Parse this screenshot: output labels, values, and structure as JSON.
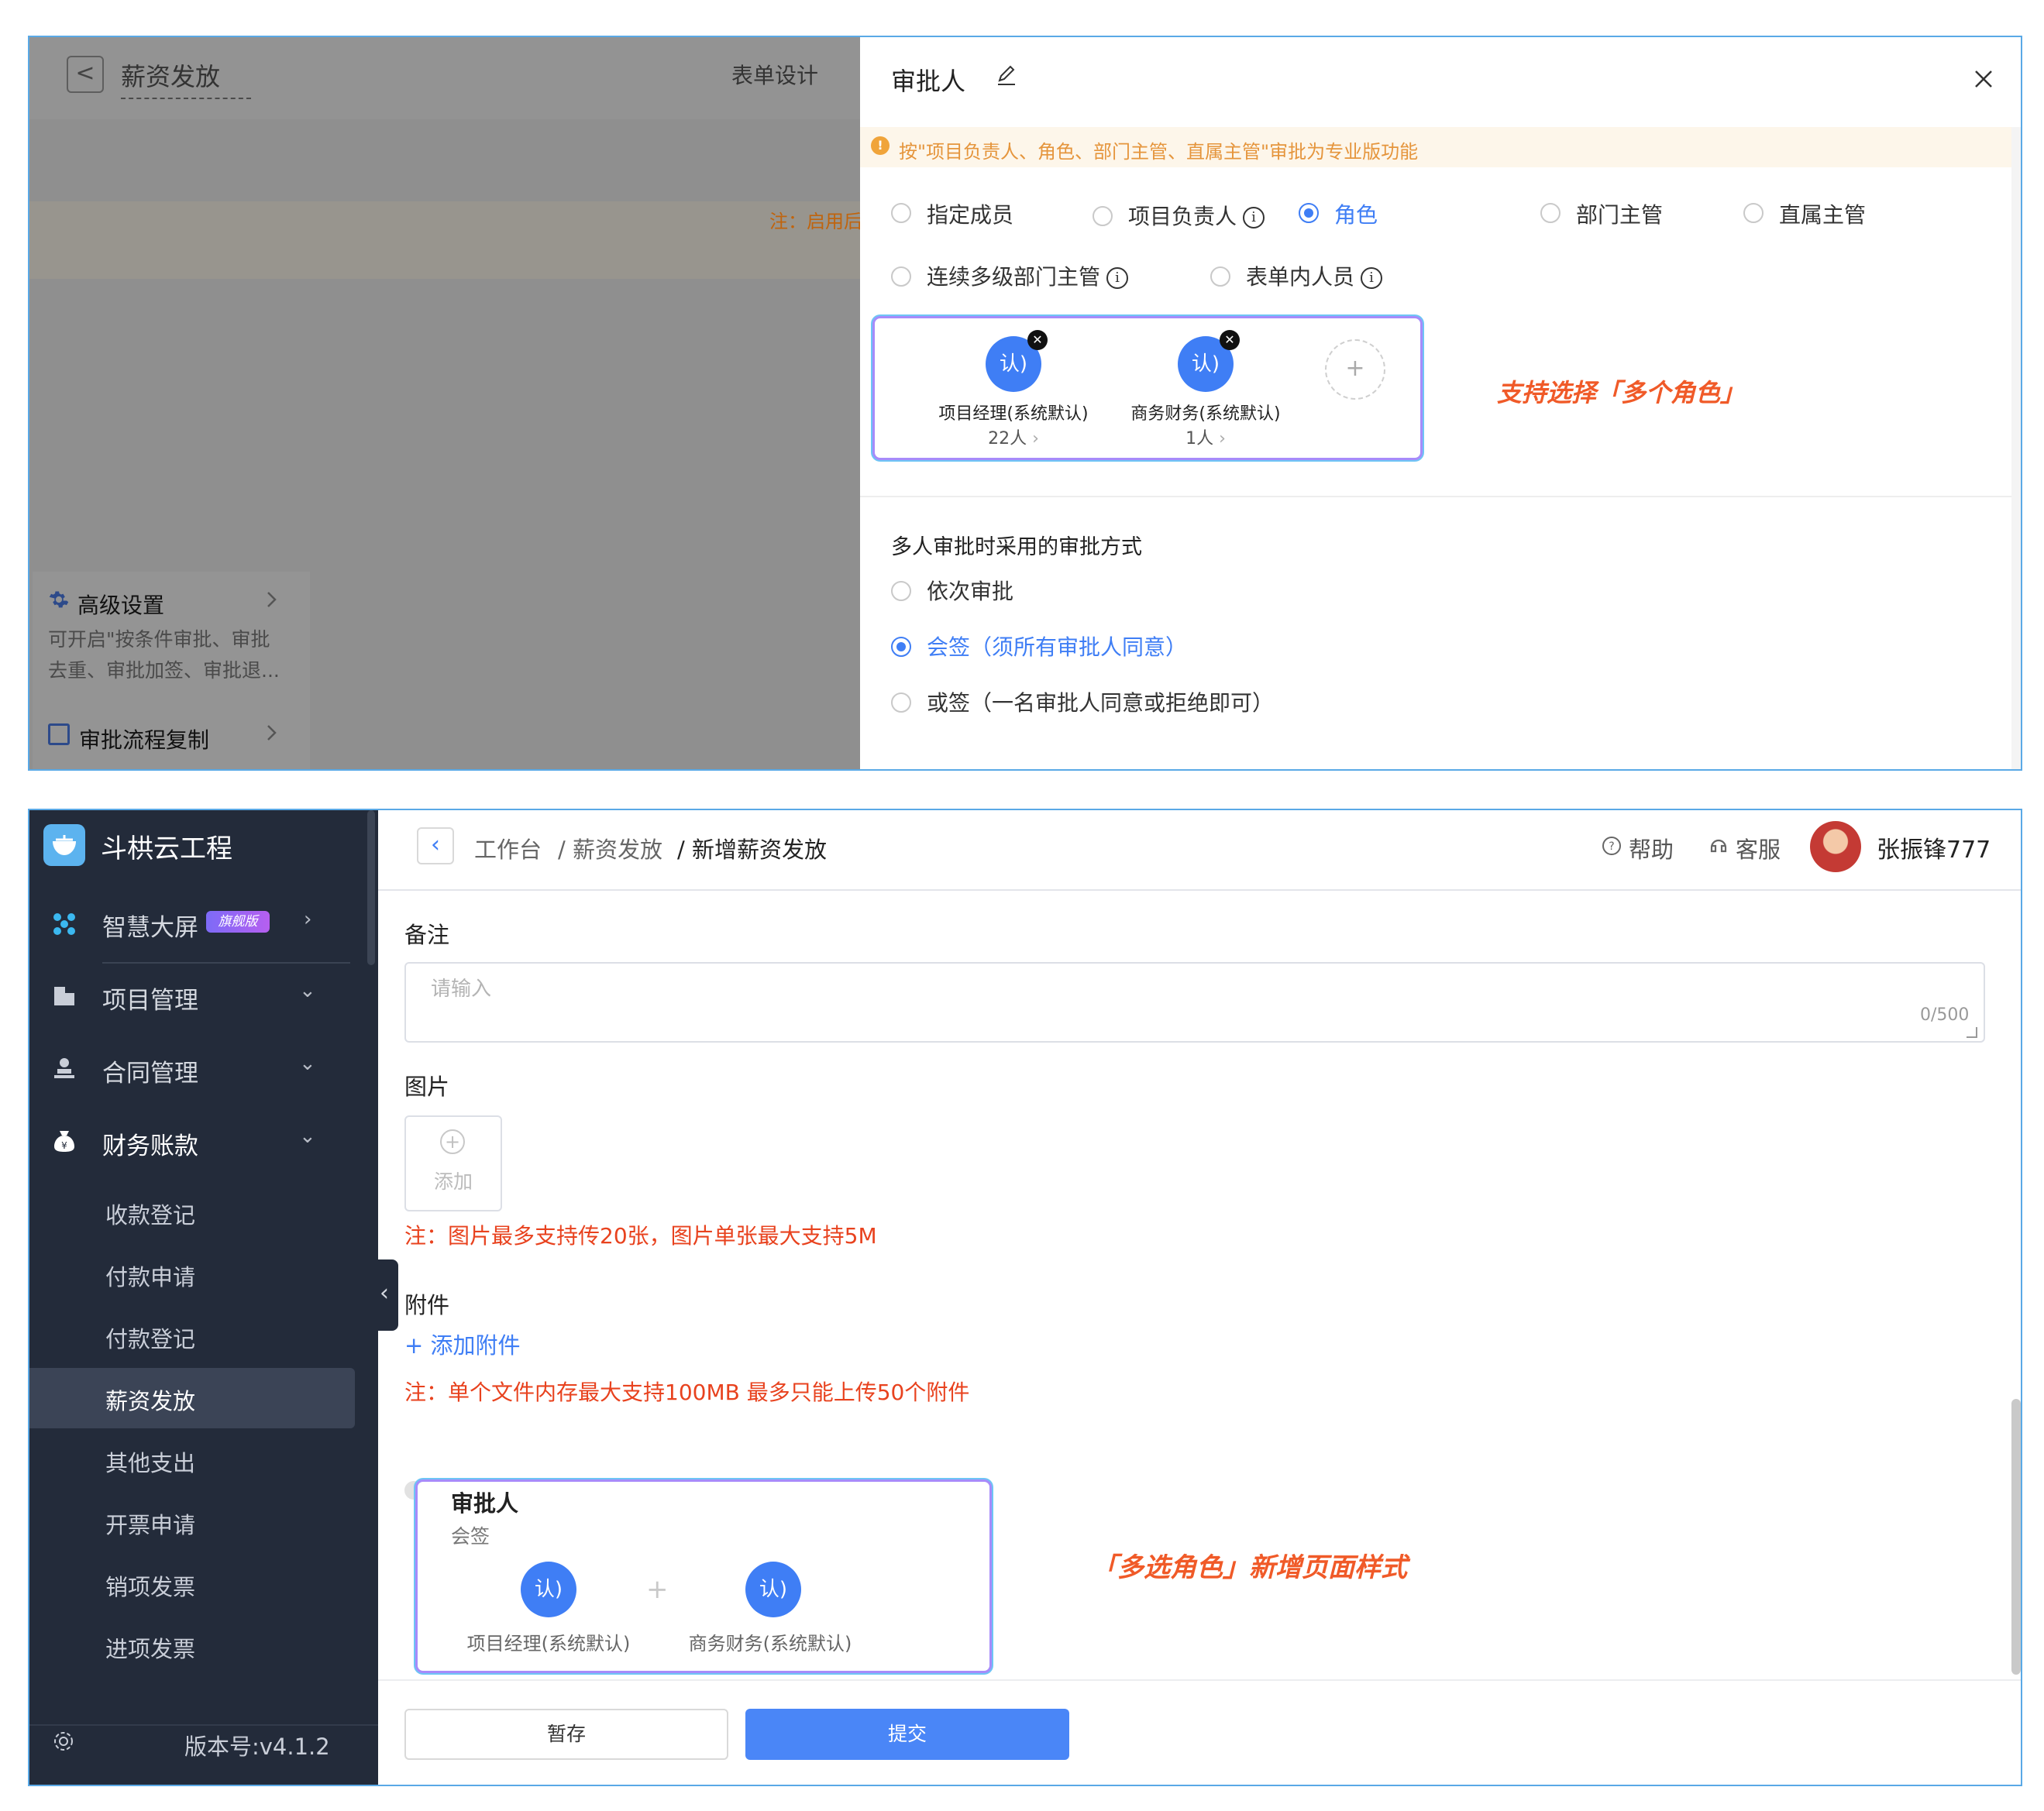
{
  "modal": {
    "back_glyph": "<",
    "bg_title": "薪资发放",
    "bg_tab": "表单设计",
    "bg_note": "注：启用后",
    "advanced": {
      "title": "高级设置",
      "desc_line1": "可开启\"按条件审批、审批",
      "desc_line2": "去重、审批加签、审批退..."
    },
    "copy": {
      "title": "审批流程复制"
    },
    "drawer": {
      "title": "审批人",
      "warning": "按\"项目负责人、角色、部门主管、直属主管\"审批为专业版功能",
      "approver_types": [
        {
          "label": "指定成员",
          "info": false
        },
        {
          "label": "项目负责人",
          "info": true
        },
        {
          "label": "角色",
          "info": false
        },
        {
          "label": "部门主管",
          "info": false
        },
        {
          "label": "直属主管",
          "info": false
        },
        {
          "label": "连续多级部门主管",
          "info": true
        },
        {
          "label": "表单内人员",
          "info": true
        }
      ],
      "selected_type": "角色",
      "roles": [
        {
          "avatar": "认)",
          "name": "项目经理(系统默认)",
          "count": "22人"
        },
        {
          "avatar": "认)",
          "name": "商务财务(系统默认)",
          "count": "1人"
        }
      ],
      "add_glyph": "+",
      "multi_role_note": "支持选择「多个角色」",
      "method_heading": "多人审批时采用的审批方式",
      "methods": [
        {
          "label": "依次审批"
        },
        {
          "label": "会签（须所有审批人同意）"
        },
        {
          "label": "或签（一名审批人同意或拒绝即可）"
        }
      ],
      "selected_method": "会签（须所有审批人同意）"
    }
  },
  "app": {
    "logo": "斗栱云工程",
    "menu": {
      "dashboard": {
        "label": "智慧大屏",
        "badge": "旗舰版"
      },
      "projects": {
        "label": "项目管理"
      },
      "contracts": {
        "label": "合同管理"
      },
      "finance": {
        "label": "财务账款",
        "items": [
          "收款登记",
          "付款申请",
          "付款登记",
          "薪资发放",
          "其他支出",
          "开票申请",
          "销项发票",
          "进项发票"
        ],
        "selected": "薪资发放"
      }
    },
    "version": "版本号:v4.1.2",
    "breadcrumb": [
      "工作台",
      "/ 薪资发放",
      "/ 新增薪资发放"
    ],
    "help": "帮助",
    "service": "客服",
    "user": "张振锋777",
    "form": {
      "remark_label": "备注",
      "remark_placeholder": "请输入",
      "remark_count": "0/500",
      "image_label": "图片",
      "image_add": "添加",
      "image_note": "注：图片最多支持传20张，图片单张最大支持5M",
      "attach_label": "附件",
      "attach_add": "+ 添加附件",
      "attach_note": "注：单个文件内存最大支持100MB 最多只能上传50个附件",
      "approver_title": "审批人",
      "approver_mode": "会签",
      "approvers": [
        {
          "avatar": "认)",
          "name": "项目经理(系统默认)"
        },
        {
          "avatar": "认)",
          "name": "商务财务(系统默认)"
        }
      ],
      "approver_plus": "+",
      "style_note": "「多选角色」新增页面样式"
    },
    "buttons": {
      "save": "暂存",
      "submit": "提交"
    }
  },
  "colors": {
    "primary": "#3f7ef5",
    "note_red": "#e8421e",
    "annotation_orange": "#f05a28",
    "warning": "#e5953c",
    "sidebar": "#232b3a"
  }
}
